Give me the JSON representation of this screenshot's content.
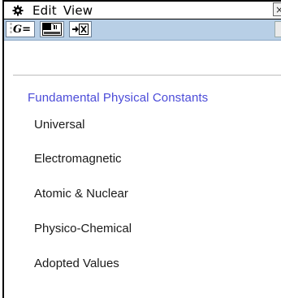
{
  "menubar": {
    "gear_icon": "gear-icon",
    "items": [
      "Edit",
      "View"
    ],
    "close_label": "×"
  },
  "toolbar": {
    "g_button_label": "G=",
    "hydrogen_button_label": "Hydrogen",
    "hydrogen_symbol": "H",
    "hydrogen_number": "1",
    "x_button_icon": "arrow-x-icon"
  },
  "content": {
    "heading": "Fundamental Physical Constants",
    "items": [
      "Universal",
      "Electromagnetic",
      "Atomic & Nuclear",
      "Physico-Chemical",
      "Adopted Values"
    ]
  },
  "colors": {
    "heading": "#4b4bd8",
    "toolbar_bg": "#b8cfe6"
  }
}
